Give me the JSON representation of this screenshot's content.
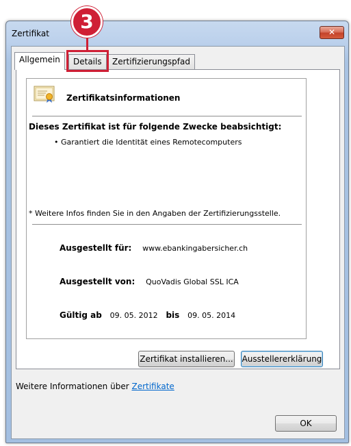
{
  "window": {
    "title": "Zertifikat",
    "close_symbol": "✕"
  },
  "annotation": {
    "step_number": "3"
  },
  "tabs": [
    {
      "label": "Allgemein",
      "active": true
    },
    {
      "label": "Details",
      "active": false
    },
    {
      "label": "Zertifizierungspfad",
      "active": false
    }
  ],
  "info": {
    "header_icon": "certificate-icon",
    "title": "Zertifikatsinformationen",
    "purpose_title": "Dieses Zertifikat ist für folgende Zwecke beabsichtigt:",
    "purposes": [
      "• Garantiert die Identität eines Remotecomputers"
    ],
    "note": "* Weitere Infos finden Sie in den Angaben der Zertifizierungsstelle.",
    "issued_to_label": "Ausgestellt für:",
    "issued_to_value": "www.ebankingabersicher.ch",
    "issued_by_label": "Ausgestellt von:",
    "issued_by_value": "QuoVadis Global SSL ICA",
    "valid_from_label": "Gültig ab",
    "valid_from_value": "09. 05. 2012",
    "valid_to_label": "bis",
    "valid_to_value": "09. 05. 2014"
  },
  "buttons": {
    "install": "Zertifikat installieren...",
    "issuer_statement": "Ausstellererklärung",
    "ok": "OK"
  },
  "footer": {
    "more_info_text": "Weitere Informationen über",
    "more_info_link": "Zertifikate"
  },
  "colors": {
    "highlight": "#cf1f35",
    "link": "#0066cc",
    "frame": "#a9c3e3"
  }
}
